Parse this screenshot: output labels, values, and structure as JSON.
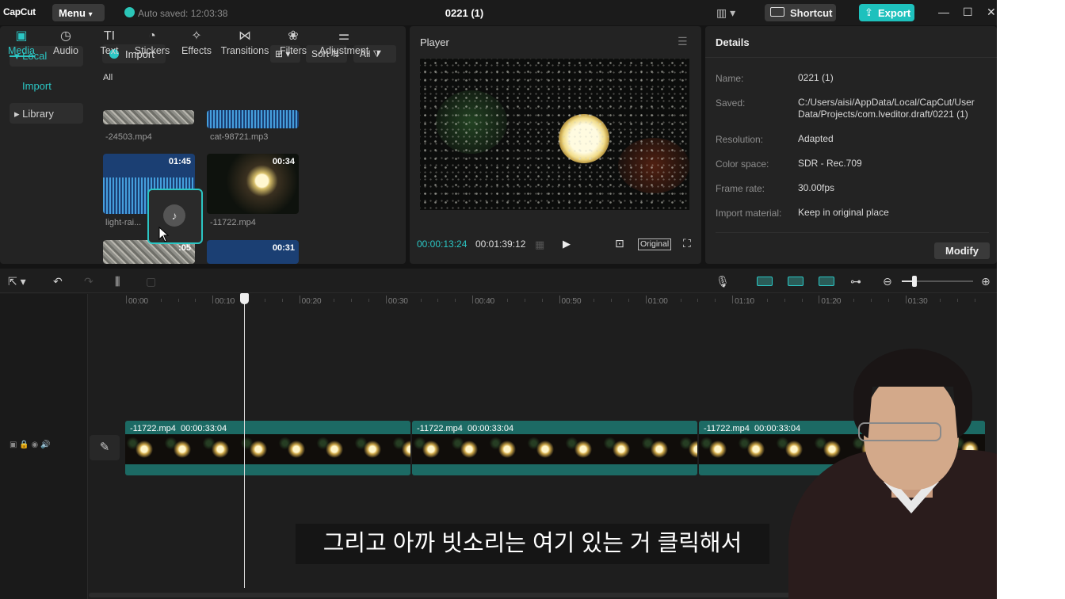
{
  "titlebar": {
    "logo": "CapCut",
    "menu_label": "Menu",
    "menu_caret": "▾",
    "autosave": "Auto saved: 12:03:38",
    "project_title": "0221 (1)",
    "shortcut_label": "Shortcut",
    "export_label": "Export"
  },
  "tools": [
    {
      "label": "Media",
      "icon": "media-icon",
      "glyph": "▣"
    },
    {
      "label": "Audio",
      "icon": "audio-icon",
      "glyph": "◷"
    },
    {
      "label": "Text",
      "icon": "text-icon",
      "glyph": "TI"
    },
    {
      "label": "Stickers",
      "icon": "stickers-icon",
      "glyph": "◔"
    },
    {
      "label": "Effects",
      "icon": "effects-icon",
      "glyph": "✧"
    },
    {
      "label": "Transitions",
      "icon": "transitions-icon",
      "glyph": "⋈"
    },
    {
      "label": "Filters",
      "icon": "filters-icon",
      "glyph": "❀"
    },
    {
      "label": "Adjustment",
      "icon": "adjustment-icon",
      "glyph": "⚌"
    }
  ],
  "sidebar": {
    "local": "▾ Local",
    "import": "Import",
    "library": "▸ Library"
  },
  "media": {
    "import_label": "Import",
    "view_glyph": "⊞ ▾",
    "sort_label": "Sort ⇅",
    "all_filter_label": "All ⧩",
    "section_label": "All",
    "items": [
      {
        "name": "-24503.mp4",
        "duration": ""
      },
      {
        "name": "cat-98721.mp3",
        "duration": ""
      },
      {
        "name": "light-rai...",
        "duration": "01:45"
      },
      {
        "name": "-11722.mp4",
        "duration": "00:34"
      },
      {
        "name": "",
        "duration": ":05"
      },
      {
        "name": "",
        "duration": "00:31"
      }
    ],
    "drag_glyph": "♪"
  },
  "player": {
    "title": "Player",
    "menu_glyph": "☰",
    "current_time": "00:00:13:24",
    "total_time": "00:01:39:12",
    "grid_glyph": "▦",
    "play_glyph": "▶",
    "screenshot_glyph": "⊡",
    "ratio_label": "Original",
    "fullscreen_glyph": "⛶"
  },
  "details": {
    "title": "Details",
    "rows": [
      {
        "label": "Name:",
        "value": "0221 (1)"
      },
      {
        "label": "Saved:",
        "value": "C:/Users/aisi/AppData/Local/CapCut/User Data/Projects/com.lveditor.draft/0221 (1)"
      },
      {
        "label": "Resolution:",
        "value": "Adapted"
      },
      {
        "label": "Color space:",
        "value": "SDR - Rec.709"
      },
      {
        "label": "Frame rate:",
        "value": "30.00fps"
      },
      {
        "label": "Import material:",
        "value": "Keep in original place"
      }
    ],
    "modify_label": "Modify"
  },
  "timeline": {
    "toolbar_glyphs": {
      "select": "⇱ ▾",
      "undo": "↶",
      "redo": "↷",
      "split": "⫼",
      "delete": "▢",
      "mic": "🎙",
      "zoom_out": "⊖",
      "zoom_in": "⊕",
      "link": "⊶"
    },
    "ruler": [
      "00:00",
      "00:10",
      "00:20",
      "00:30",
      "00:40",
      "00:50",
      "01:00",
      "01:10",
      "01:20",
      "01:30"
    ],
    "track_icons": "▣   🔒   ◉   🔊",
    "edit_glyph": "✎",
    "clips": [
      {
        "name": "-11722.mp4",
        "duration": "00:00:33:04"
      },
      {
        "name": "-11722.mp4",
        "duration": "00:00:33:04"
      },
      {
        "name": "-11722.mp4",
        "duration": "00:00:33:04"
      }
    ]
  },
  "subtitle": "그리고 아까 빗소리는 여기 있는 거 클릭해서",
  "colors": {
    "accent": "#2bc6c4",
    "export": "#1ec1bd",
    "clip": "#1c6a64"
  }
}
